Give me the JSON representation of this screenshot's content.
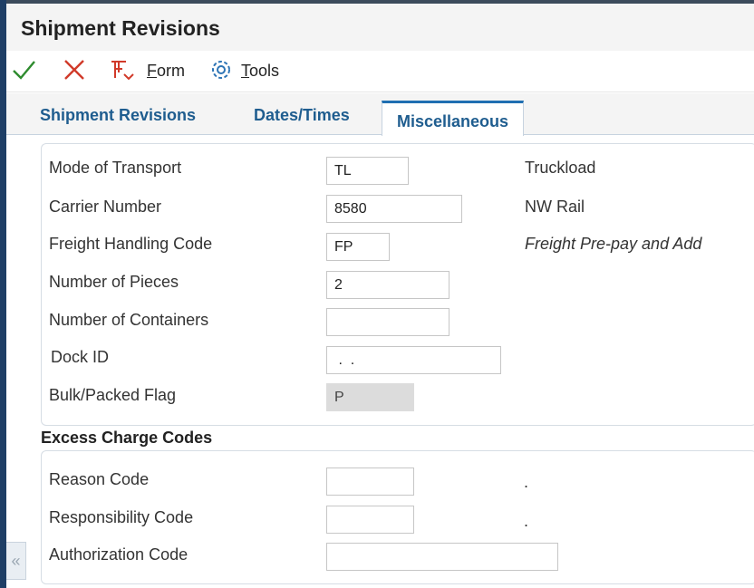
{
  "header": {
    "title": "Shipment Revisions"
  },
  "toolbar": {
    "ok_icon": "checkmark-icon",
    "cancel_icon": "close-x-icon",
    "form_icon": "form-menu-icon",
    "tools_icon": "gear-icon",
    "form_label_accel": "F",
    "form_label_rest": "orm",
    "tools_label_accel": "T",
    "tools_label_rest": "ools",
    "colors": {
      "check": "#2e8b2e",
      "x": "#d13a2a",
      "form": "#d13a2a",
      "gear": "#2d74b5"
    }
  },
  "tabs": [
    {
      "label": "Shipment Revisions",
      "active": false
    },
    {
      "label": "Dates/Times",
      "active": false
    },
    {
      "label": "Miscellaneous",
      "active": true
    }
  ],
  "misc": {
    "mode_of_transport": {
      "label": "Mode of Transport",
      "value": "TL",
      "description": "Truckload"
    },
    "carrier_number": {
      "label": "Carrier Number",
      "value": "8580",
      "description": "NW Rail"
    },
    "freight_handling_code": {
      "label": "Freight Handling Code",
      "value": "FP",
      "description": "Freight Pre-pay and Add"
    },
    "number_of_pieces": {
      "label": "Number of Pieces",
      "value": "2"
    },
    "number_of_containers": {
      "label": "Number of Containers",
      "value": ""
    },
    "dock_id": {
      "label": "Dock ID",
      "value": " .  ."
    },
    "bulk_packed_flag": {
      "label": "Bulk/Packed Flag",
      "value": "P"
    }
  },
  "excess_charge_codes": {
    "title": "Excess Charge Codes",
    "reason_code": {
      "label": "Reason Code",
      "value": "",
      "description": "."
    },
    "responsibility_code": {
      "label": "Responsibility Code",
      "value": "",
      "description": "."
    },
    "authorization_code": {
      "label": "Authorization Code",
      "value": ""
    }
  },
  "collapse_glyph": "«",
  "accent_color": "#1f5d8f"
}
